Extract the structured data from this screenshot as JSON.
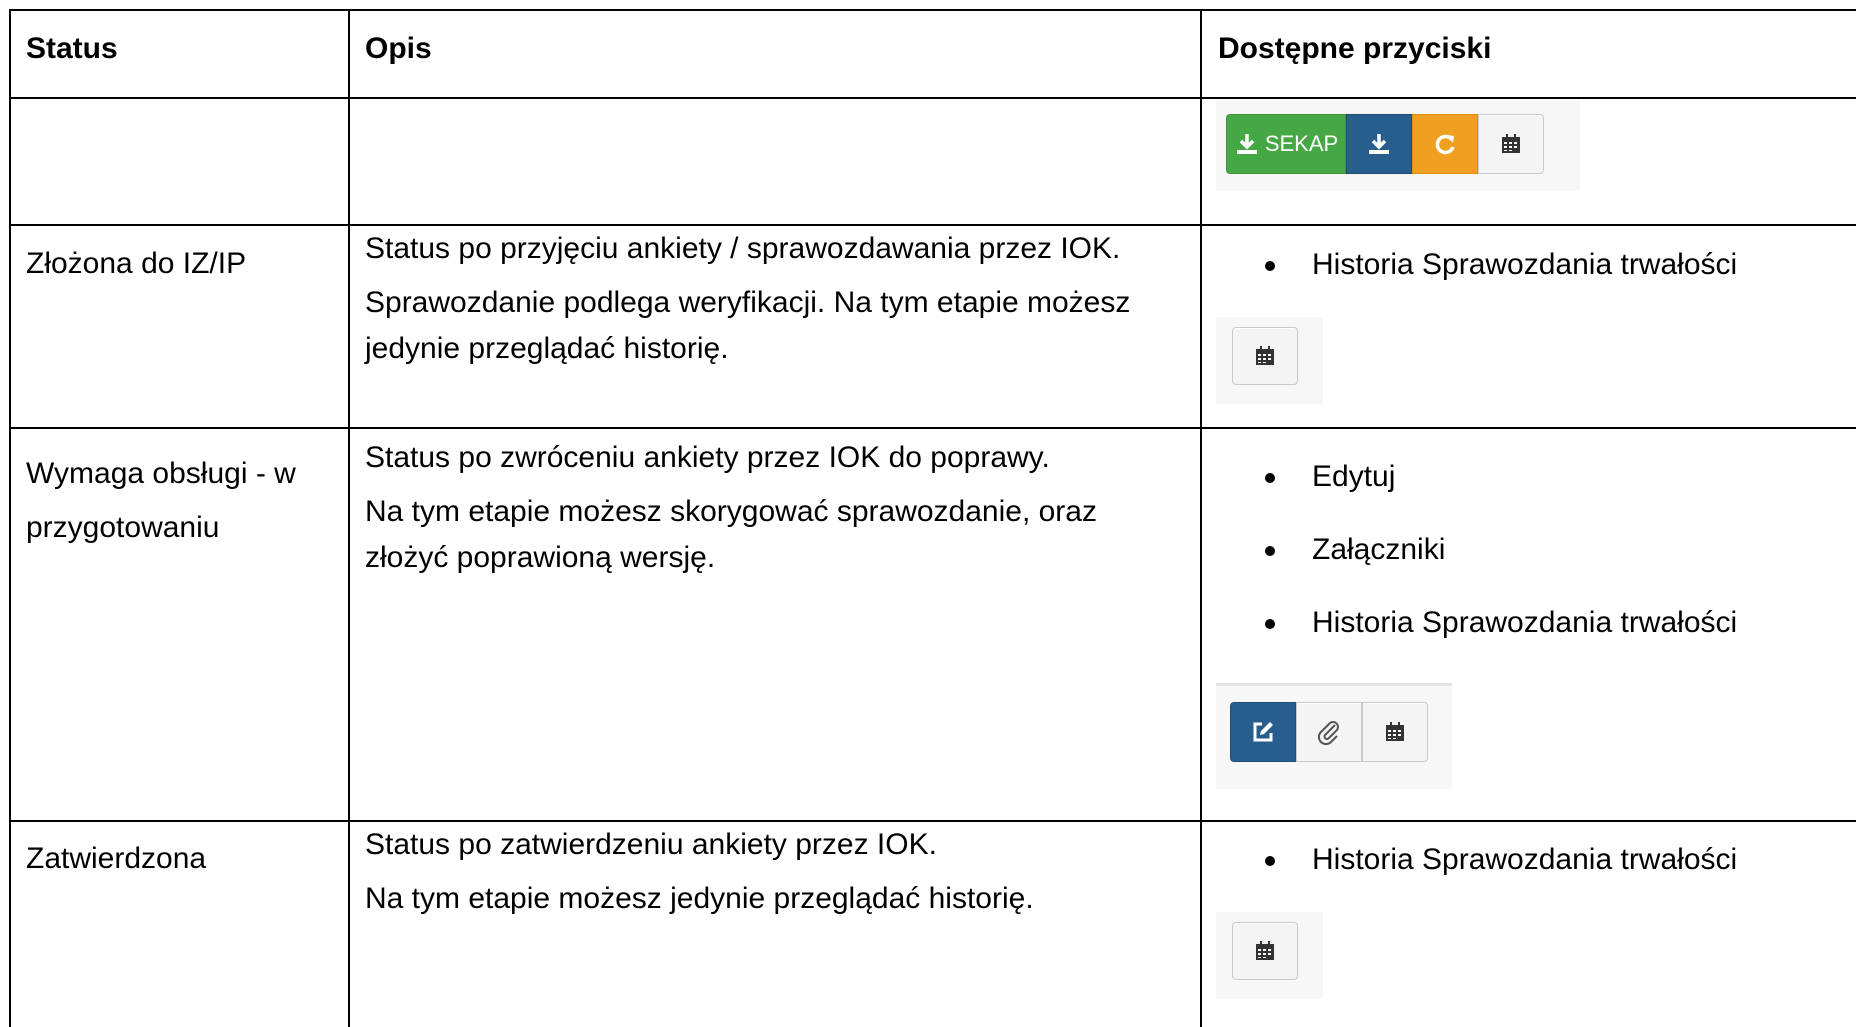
{
  "headers": {
    "status": "Status",
    "description": "Opis",
    "buttons": "Dostępne przyciski"
  },
  "rows": [
    {
      "status": "",
      "buttons_image": {
        "sekap_label": "SEKAP",
        "icons": [
          "download-icon",
          "download-icon",
          "refresh-icon",
          "calendar-icon"
        ],
        "colors": {
          "green": "#45a845",
          "blue": "#285e8e",
          "orange": "#f0a020"
        }
      }
    },
    {
      "status": "Złożona do IZ/IP",
      "description": [
        "Status po przyjęciu ankiety / sprawozdawania przez IOK.",
        "Sprawozdanie podlega weryfikacji. Na tym etapie możesz",
        "jedynie przeglądać historię."
      ],
      "bullets": [
        "Historia Sprawozdania trwałości"
      ],
      "buttons_image": {
        "icons": [
          "calendar-icon"
        ]
      }
    },
    {
      "status_line1": "Wymaga obsługi - w",
      "status_line2": "przygotowaniu",
      "description": [
        "Status po zwróceniu ankiety przez IOK do poprawy.",
        "Na tym etapie możesz skorygować sprawozdanie, oraz",
        "złożyć poprawioną wersję."
      ],
      "bullets": [
        "Edytuj",
        "Załączniki",
        "Historia Sprawozdania trwałości"
      ],
      "buttons_image": {
        "icons": [
          "edit-icon",
          "paperclip-icon",
          "calendar-icon"
        ]
      }
    },
    {
      "status": "Zatwierdzona",
      "description": [
        "Status po zatwierdzeniu ankiety przez IOK.",
        "Na tym etapie możesz jedynie przeglądać historię."
      ],
      "bullets": [
        "Historia Sprawozdania trwałości"
      ],
      "buttons_image": {
        "icons": [
          "calendar-icon"
        ]
      }
    }
  ]
}
